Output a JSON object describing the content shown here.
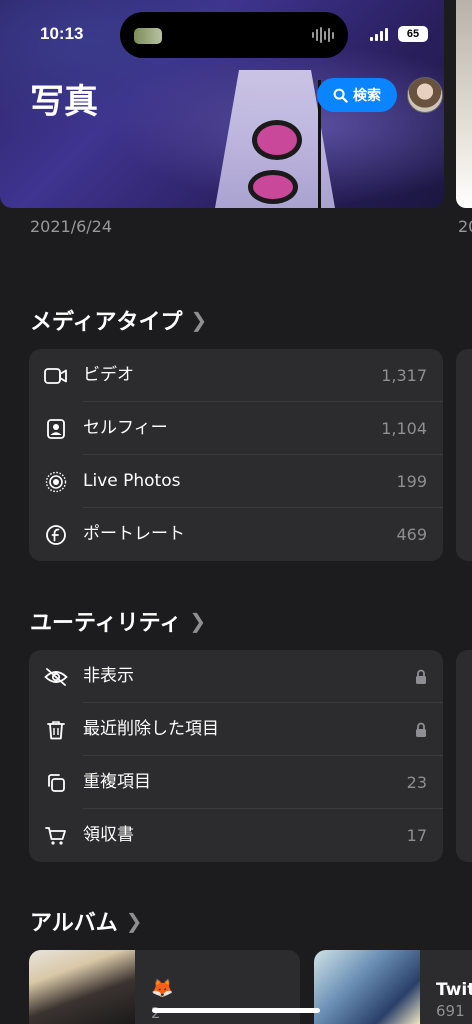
{
  "status": {
    "time": "10:13",
    "battery": "65"
  },
  "header": {
    "title": "写真",
    "search_label": "検索",
    "photo_date": "2021/6/24",
    "next_photo_date": "20"
  },
  "media_types": {
    "heading": "メディアタイプ",
    "items": [
      {
        "label": "ビデオ",
        "count": "1,317",
        "icon": "video-icon"
      },
      {
        "label": "セルフィー",
        "count": "1,104",
        "icon": "selfie-icon"
      },
      {
        "label": "Live Photos",
        "count": "199",
        "icon": "live-photos-icon"
      },
      {
        "label": "ポートレート",
        "count": "469",
        "icon": "portrait-icon"
      }
    ]
  },
  "utilities": {
    "heading": "ユーティリティ",
    "items": [
      {
        "label": "非表示",
        "locked": true,
        "icon": "hidden-eye-icon"
      },
      {
        "label": "最近削除した項目",
        "locked": true,
        "icon": "trash-icon"
      },
      {
        "label": "重複項目",
        "count": "23",
        "icon": "duplicates-icon"
      },
      {
        "label": "領収書",
        "count": "17",
        "icon": "cart-icon"
      }
    ]
  },
  "albums": {
    "heading": "アルバム",
    "items": [
      {
        "name": "🦊",
        "count": "2"
      },
      {
        "name": "Twit",
        "count": "691"
      }
    ]
  },
  "colors": {
    "background": "#1c1c1e",
    "card": "#2c2c2e",
    "accent": "#0a84ff",
    "secondary_text": "#8e8e93"
  }
}
